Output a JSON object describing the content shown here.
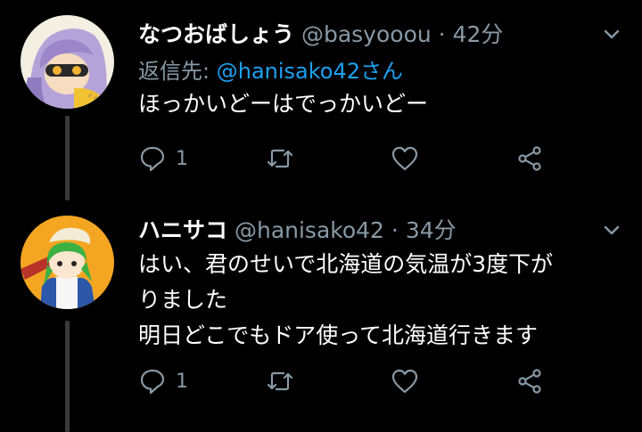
{
  "tweets": [
    {
      "name": "なつおばしょう",
      "handle": "@basyooou",
      "separator": "·",
      "time": "42分",
      "reply_label": "返信先:",
      "reply_mention": "@hanisako42さん",
      "text": [
        "ほっかいどーはでっかいどー"
      ],
      "reply_count": "1"
    },
    {
      "name": "ハニサコ",
      "handle": "@hanisako42",
      "separator": "·",
      "time": "34分",
      "text": [
        "はい、君のせいで北海道の気温が3度下が",
        "りました",
        "明日どこでもドア使って北海道行きます"
      ],
      "reply_count": "1"
    }
  ],
  "icons": {
    "reply": "reply-icon",
    "retweet": "retweet-icon",
    "like": "heart-icon",
    "share": "share-icon",
    "menu": "chevron-down-icon"
  },
  "colors": {
    "background": "#000000",
    "text": "#ffffff",
    "secondary": "#8899a6",
    "link": "#1da1f2",
    "thread_line": "#3a3a3a"
  }
}
